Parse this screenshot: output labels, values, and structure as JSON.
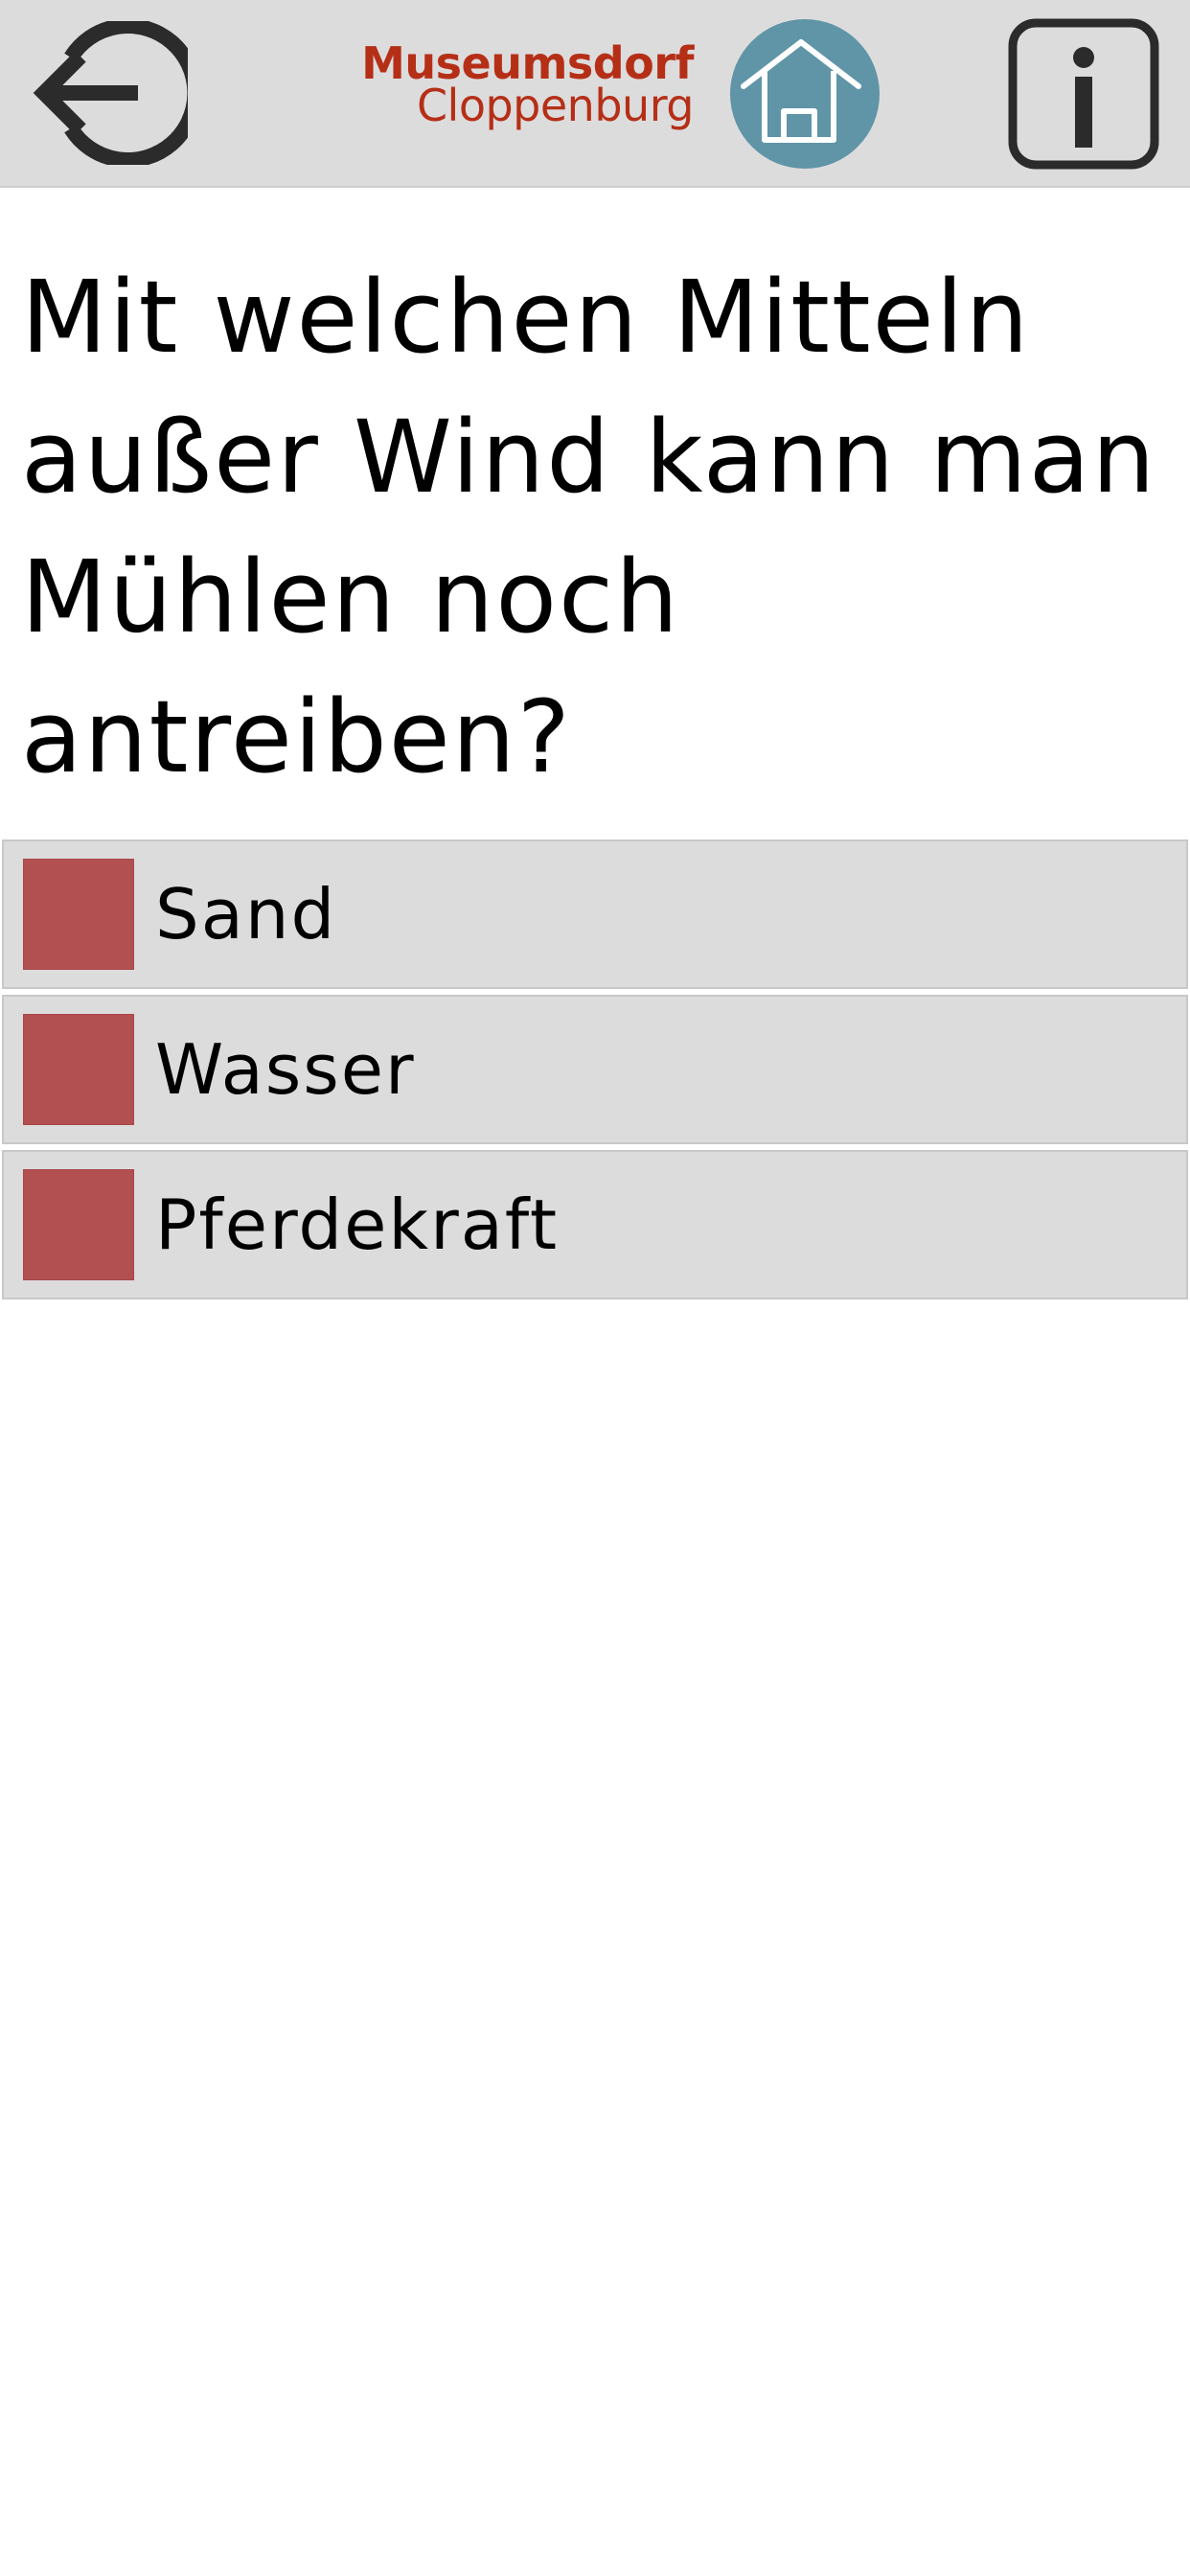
{
  "header": {
    "logo_line1": "Museumsdorf",
    "logo_line2": "Cloppenburg",
    "back_icon": "logout-arrow-icon",
    "home_icon": "home-icon",
    "info_icon": "info-icon"
  },
  "question": {
    "text": "Mit welchen Mitteln außer Wind kann man Mühlen noch antreiben?"
  },
  "answers": [
    {
      "label": "Sand",
      "checked": false
    },
    {
      "label": "Wasser",
      "checked": false
    },
    {
      "label": "Pferdekraft",
      "checked": false
    }
  ],
  "colors": {
    "header_bg": "#dddcdd",
    "brand_red": "#b52f17",
    "home_circle": "#5f95a7",
    "checkbox": "#b24f51",
    "answer_bg": "#dddcdd",
    "icon_dark": "#2b2b2b"
  }
}
